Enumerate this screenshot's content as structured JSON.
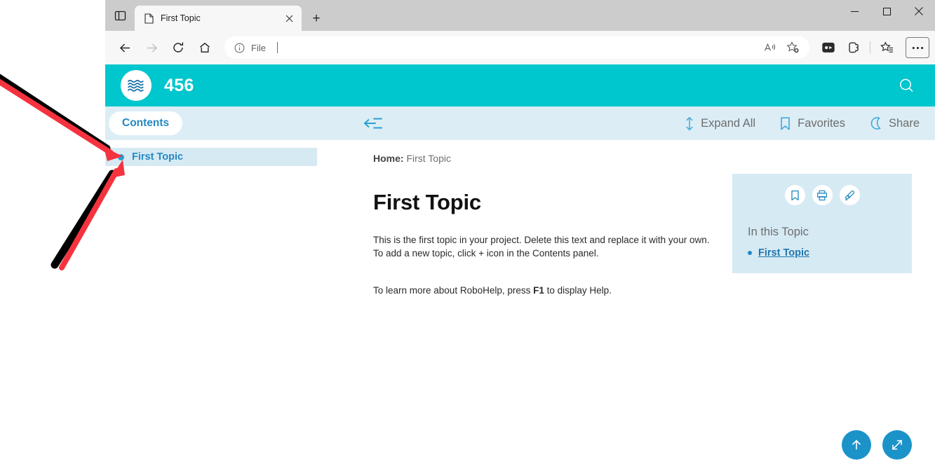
{
  "browser": {
    "tab": {
      "title": "First Topic",
      "favicon_icon": "page-icon",
      "close_icon": "close-icon"
    },
    "tabstrip_icon": "tab-list-icon",
    "newtab_label": "+",
    "window_controls": {
      "minimize": "—",
      "maximize": "□",
      "close": "✕"
    },
    "nav": {
      "back_icon": "back-arrow-icon",
      "forward_icon": "forward-arrow-icon",
      "refresh_icon": "refresh-icon",
      "home_icon": "home-icon"
    },
    "omnibox": {
      "info_icon": "info-icon",
      "value": "File",
      "read_aloud_icon": "read-aloud-icon",
      "add_favorite_icon": "add-favorite-icon"
    },
    "toolbar": {
      "collections_icon": "split-screen-icon",
      "browser_essentials_icon": "browser-essentials-icon",
      "favorites_icon": "favorites-list-icon",
      "settings_icon": "more-options-icon"
    }
  },
  "app": {
    "header": {
      "logo_icon": "waves-logo-icon",
      "title": "456",
      "search_icon": "search-icon",
      "accent_color": "#00c6cd"
    },
    "toolbar": {
      "contents_label": "Contents",
      "collapse_icon": "collapse-sidebar-icon",
      "actions": [
        {
          "label": "Expand All",
          "icon": "expand-all-icon"
        },
        {
          "label": "Favorites",
          "icon": "bookmark-icon"
        },
        {
          "label": "Share",
          "icon": "share-icon"
        }
      ],
      "background_color": "#dcedf5"
    },
    "sidebar": {
      "items": [
        {
          "label": "First Topic",
          "selected": true
        }
      ]
    },
    "content": {
      "breadcrumb": {
        "root": "Home:",
        "current": "First Topic"
      },
      "title": "First Topic",
      "paragraph1": "This is the first topic in your project. Delete this text and replace it with your own. To add a new topic, click + icon in the Contents panel.",
      "paragraph2_before": "To learn more about RoboHelp, press ",
      "paragraph2_key": "F1",
      "paragraph2_after": " to display Help."
    },
    "side_panel": {
      "icons": [
        {
          "name": "bookmark-icon"
        },
        {
          "name": "print-icon"
        },
        {
          "name": "highlighter-icon"
        }
      ],
      "heading": "In this Topic",
      "links": [
        {
          "label": "First Topic"
        }
      ]
    },
    "fabs": [
      {
        "name": "scroll-to-top-button",
        "icon": "up-arrow-icon"
      },
      {
        "name": "expand-view-button",
        "icon": "diagonal-expand-icon"
      }
    ]
  },
  "annotation": {
    "arrow_color": "#f5333f",
    "shadow_color": "#000000",
    "count": 2
  }
}
